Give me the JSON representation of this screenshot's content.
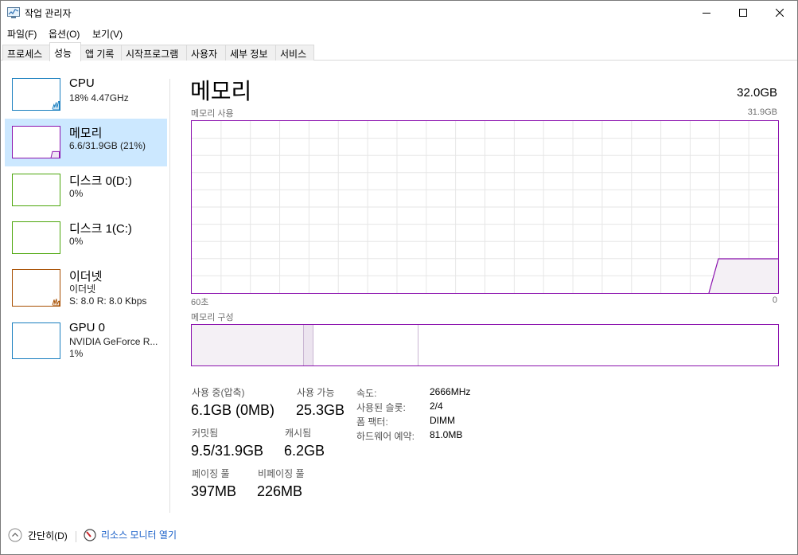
{
  "window": {
    "title": "작업 관리자"
  },
  "menu": [
    {
      "label": "파일(F)"
    },
    {
      "label": "옵션(O)"
    },
    {
      "label": "보기(V)"
    }
  ],
  "tabs": [
    {
      "label": "프로세스"
    },
    {
      "label": "성능",
      "active": true
    },
    {
      "label": "앱 기록"
    },
    {
      "label": "시작프로그램"
    },
    {
      "label": "사용자"
    },
    {
      "label": "세부 정보"
    },
    {
      "label": "서비스"
    }
  ],
  "sidebar": {
    "items": [
      {
        "name": "CPU",
        "line1": "18% 4.47GHz",
        "line2": "",
        "color": "#1a7fbf",
        "usage_percent": 18
      },
      {
        "name": "메모리",
        "line1": "6.6/31.9GB (21%)",
        "line2": "",
        "color": "#8b12ae",
        "usage_percent": 21,
        "selected": true
      },
      {
        "name": "디스크 0(D:)",
        "line1": "0%",
        "line2": "",
        "color": "#4da60c",
        "usage_percent": 0
      },
      {
        "name": "디스크 1(C:)",
        "line1": "0%",
        "line2": "",
        "color": "#4da60c",
        "usage_percent": 0
      },
      {
        "name": "이더넷",
        "line1": "이더넷",
        "line2": "S: 8.0  R: 8.0 Kbps",
        "color": "#a74f01",
        "usage_percent": 5
      },
      {
        "name": "GPU 0",
        "line1": "NVIDIA GeForce R...",
        "line2": "1%",
        "color": "#1a7fbf",
        "usage_percent": 1
      }
    ]
  },
  "main": {
    "title": "메모리",
    "total": "32.0GB",
    "usage_label": "메모리 사용",
    "usage_max": "31.9GB",
    "axis_left": "60초",
    "axis_right": "0",
    "composition_label": "메모리 구성",
    "stats": {
      "in_use_label": "사용 중(압축)",
      "in_use_value": "6.1GB (0MB)",
      "available_label": "사용 가능",
      "available_value": "25.3GB",
      "committed_label": "커밋됨",
      "committed_value": "9.5/31.9GB",
      "cached_label": "캐시됨",
      "cached_value": "6.2GB",
      "paged_label": "페이징 풀",
      "paged_value": "397MB",
      "nonpaged_label": "비페이징 풀",
      "nonpaged_value": "226MB"
    },
    "specs": [
      {
        "label": "속도:",
        "value": "2666MHz"
      },
      {
        "label": "사용된 슬롯:",
        "value": "2/4"
      },
      {
        "label": "폼 팩터:",
        "value": "DIMM"
      },
      {
        "label": "하드웨어 예약:",
        "value": "81.0MB"
      }
    ]
  },
  "footer": {
    "fewer_details": "간단히(D)",
    "resource_monitor": "리소스 모니터 열기"
  },
  "colors": {
    "memory": "#8b12ae",
    "memory_fill": "#f4f2f4",
    "grid": "#e6e6e6",
    "selected_bg": "#cce8ff",
    "link": "#1b61c9"
  }
}
